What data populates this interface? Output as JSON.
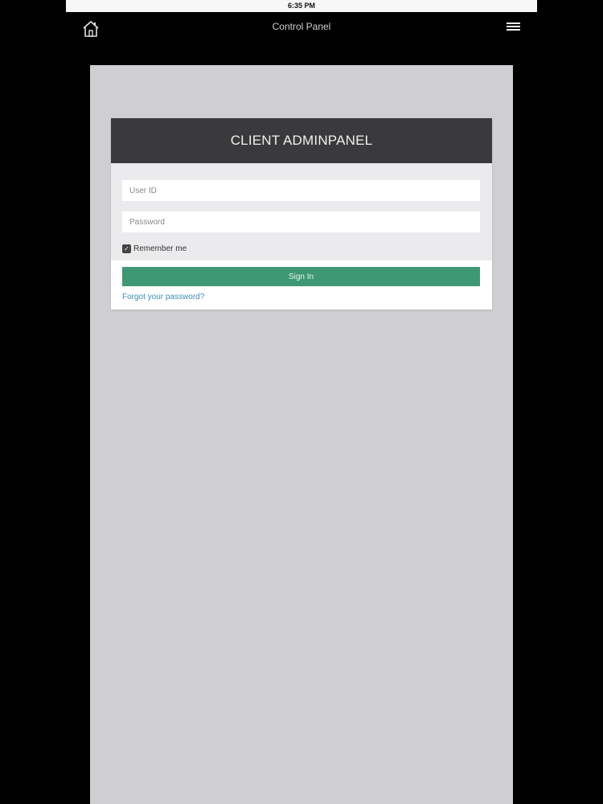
{
  "status_bar": {
    "time": "6:35 PM"
  },
  "nav": {
    "title": "Control Panel",
    "home_icon": "home-icon",
    "menu_icon": "hamburger-menu-icon"
  },
  "login": {
    "header": "CLIENT ADMINPANEL",
    "user_id_placeholder": "User ID",
    "password_placeholder": "Password",
    "remember_label": "Remember me",
    "remember_checked": true,
    "signin_label": "Sign In",
    "forgot_label": "Forgot your password?"
  },
  "colors": {
    "background": "#000000",
    "content_background": "#cfced1",
    "header_background": "#3a3a3c",
    "form_background": "#ebebed",
    "signin_button": "#3e9874",
    "link": "#3a8fb6"
  }
}
